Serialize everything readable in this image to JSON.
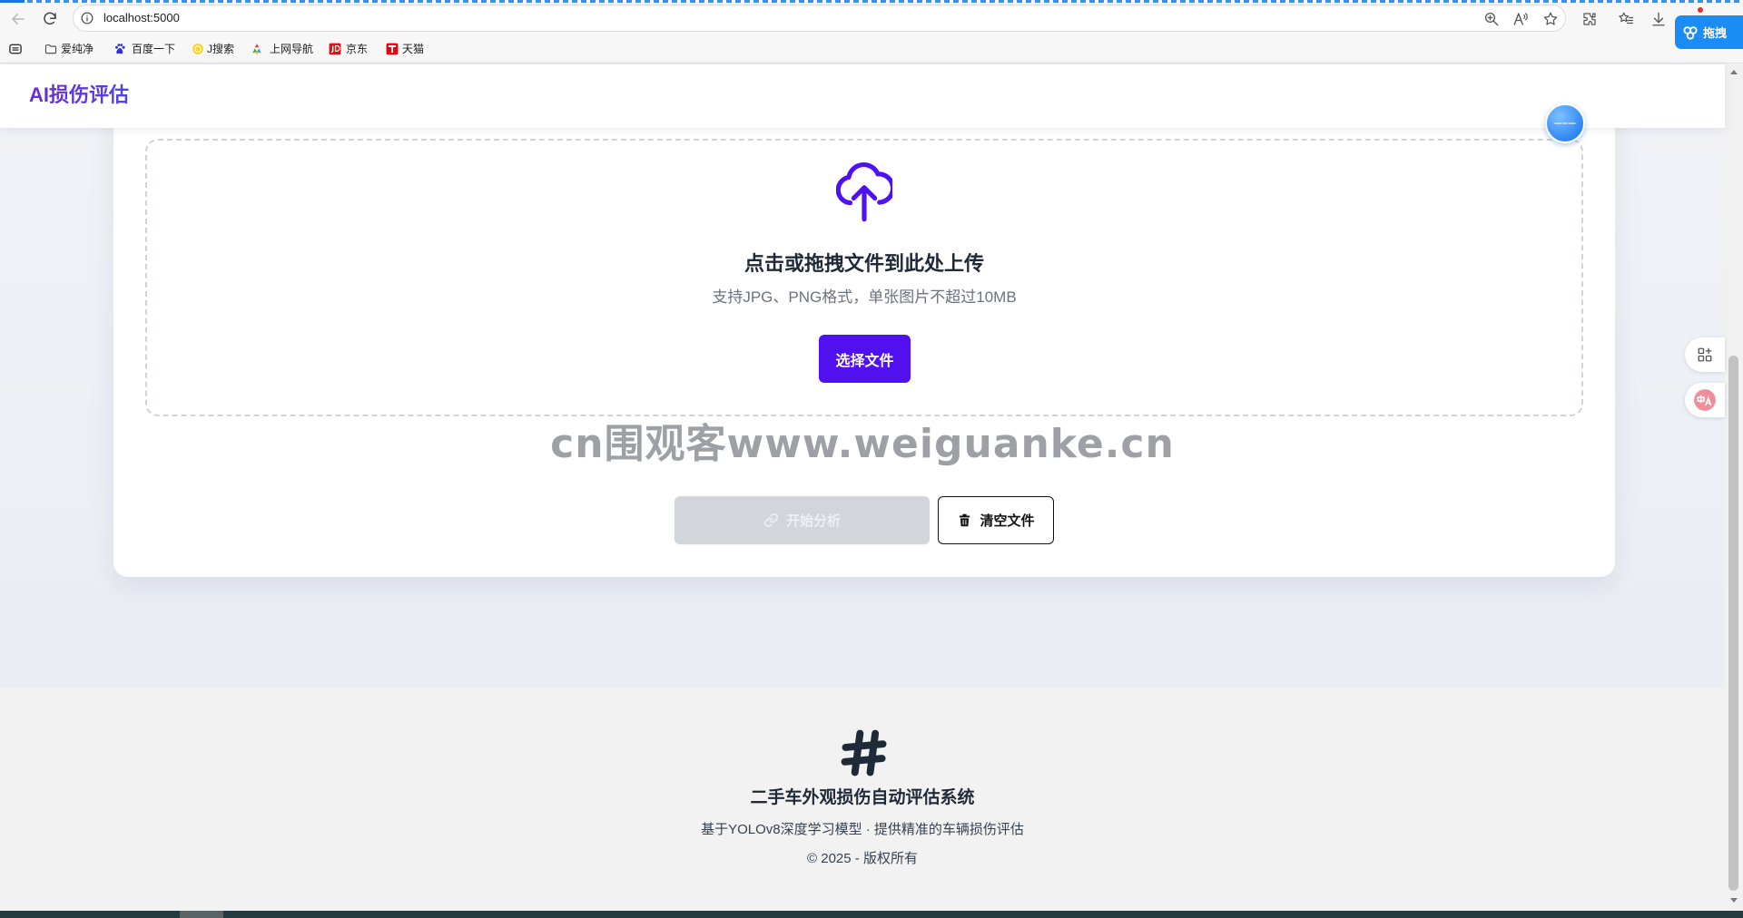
{
  "browser": {
    "url": "localhost:5000",
    "bookmarks": [
      {
        "label": "爱纯净",
        "icon": "folder-icon"
      },
      {
        "label": "百度一下",
        "icon": "baidu-paw-icon"
      },
      {
        "label": "J搜索",
        "icon": "jsearch-icon"
      },
      {
        "label": "上网导航",
        "icon": "navigation-icon"
      },
      {
        "label": "京东",
        "icon": "jd-icon"
      },
      {
        "label": "天猫",
        "icon": "tmall-icon"
      }
    ],
    "extension_label": "拖拽",
    "toolbar_icons": [
      "back-icon",
      "refresh-icon",
      "site-info-icon",
      "zoom-icon",
      "read-aloud-icon",
      "favorite-star-icon",
      "extensions-icon",
      "favorites-icon",
      "download-icon"
    ]
  },
  "header": {
    "title": "AI损伤评估"
  },
  "upload": {
    "title": "点击或拖拽文件到此处上传",
    "hint": "支持JPG、PNG格式，单张图片不超过10MB",
    "select_label": "选择文件",
    "icon": "cloud-upload-icon"
  },
  "watermark": "cn围观客www.weiguanke.cn",
  "actions": {
    "analyze_label": "开始分析",
    "analyze_disabled": true,
    "analyze_icon": "link-icon",
    "clear_label": "清空文件",
    "clear_icon": "trash-icon"
  },
  "footer": {
    "icon": "hashtag-icon",
    "title": "二手车外观损伤自动评估系统",
    "subtitle": "基于YOLOv8深度学习模型 · 提供精准的车辆损伤评估",
    "copyright": "© 2025 - 版权所有"
  },
  "side_widgets": [
    "apps-grid-icon",
    "translate-icon"
  ],
  "colors": {
    "accent": "#5010f0",
    "title_gradient_start": "#6d28d9",
    "title_gradient_end": "#4f46e5",
    "disabled_button": "#d2d5da",
    "footer_bg": "#f2f2f2",
    "extension_blue": "#1c8cf5"
  }
}
